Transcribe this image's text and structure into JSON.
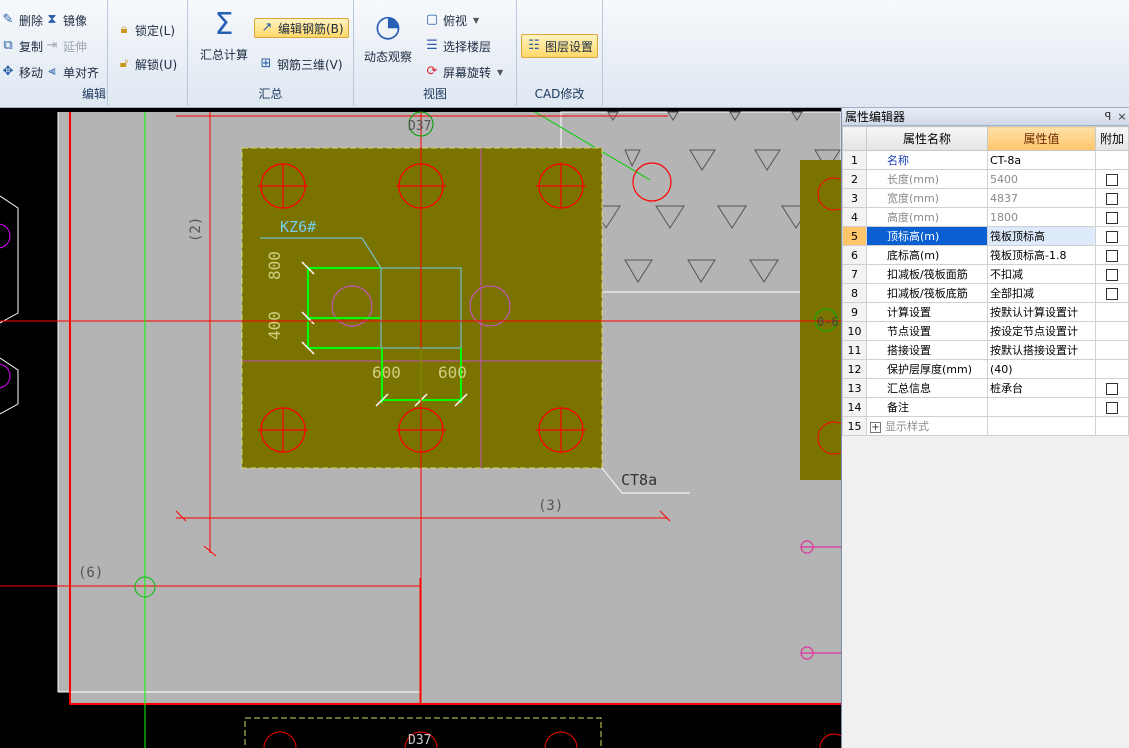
{
  "ribbon": {
    "edit": {
      "label": "编辑",
      "delete": "删除",
      "mirror": "镜像",
      "copy": "复制",
      "extend": "延伸",
      "move": "移动",
      "align": "单对齐",
      "lock": "锁定(L)",
      "unlock": "解锁(U)"
    },
    "summary": {
      "label": "汇总",
      "calc": "汇总计算",
      "edit_rebar": "编辑钢筋(B)",
      "rebar_3d": "钢筋三维(V)"
    },
    "view": {
      "label": "视图",
      "dynamic": "动态观察",
      "top_view": "俯视",
      "select_floor": "选择楼层",
      "rotate": "屏幕旋转"
    },
    "cad": {
      "label": "CAD修改",
      "layer": "图层设置"
    }
  },
  "canvas": {
    "labels": {
      "d37_top": "D37",
      "d37_bottom": "D37",
      "axis_2": "(2)",
      "axis_3": "(3)",
      "axis_6": "(6)",
      "kz": "KZ6#",
      "dim_800": "800",
      "dim_400": "400",
      "dim_600a": "600",
      "dim_600b": "600",
      "ct": "CT8a",
      "side": "0-6"
    },
    "colors": {
      "olive": "#7a7300",
      "gray": "#b4b4b4",
      "red": "#ff0000",
      "green": "#00ff00"
    }
  },
  "props": {
    "title": "属性编辑器",
    "pin": "ꟼ",
    "close": "×",
    "headers": {
      "num": "",
      "name": "属性名称",
      "value": "属性值",
      "extra": "附加"
    },
    "rows": [
      {
        "num": "1",
        "name": "名称",
        "value": "CT-8a",
        "style": "blue",
        "check": false
      },
      {
        "num": "2",
        "name": "长度(mm)",
        "value": "5400",
        "style": "gray",
        "check": true
      },
      {
        "num": "3",
        "name": "宽度(mm)",
        "value": "4837",
        "style": "gray",
        "check": true
      },
      {
        "num": "4",
        "name": "高度(mm)",
        "value": "1800",
        "style": "gray",
        "check": true
      },
      {
        "num": "5",
        "name": "顶标高(m)",
        "value": "筏板顶标高",
        "style": "sel",
        "check": true
      },
      {
        "num": "6",
        "name": "底标高(m)",
        "value": "筏板顶标高-1.8",
        "style": "",
        "check": true
      },
      {
        "num": "7",
        "name": "扣减板/筏板面筋",
        "value": "不扣减",
        "style": "",
        "check": true
      },
      {
        "num": "8",
        "name": "扣减板/筏板底筋",
        "value": "全部扣减",
        "style": "",
        "check": true
      },
      {
        "num": "9",
        "name": "计算设置",
        "value": "按默认计算设置计",
        "style": "",
        "check": false
      },
      {
        "num": "10",
        "name": "节点设置",
        "value": "按设定节点设置计",
        "style": "",
        "check": false
      },
      {
        "num": "11",
        "name": "搭接设置",
        "value": "按默认搭接设置计",
        "style": "",
        "check": false
      },
      {
        "num": "12",
        "name": "保护层厚度(mm)",
        "value": "(40)",
        "style": "",
        "check": false
      },
      {
        "num": "13",
        "name": "汇总信息",
        "value": "桩承台",
        "style": "",
        "check": true
      },
      {
        "num": "14",
        "name": "备注",
        "value": "",
        "style": "",
        "check": true
      },
      {
        "num": "15",
        "name": "显示样式",
        "value": "",
        "style": "exp",
        "check": false
      }
    ]
  }
}
